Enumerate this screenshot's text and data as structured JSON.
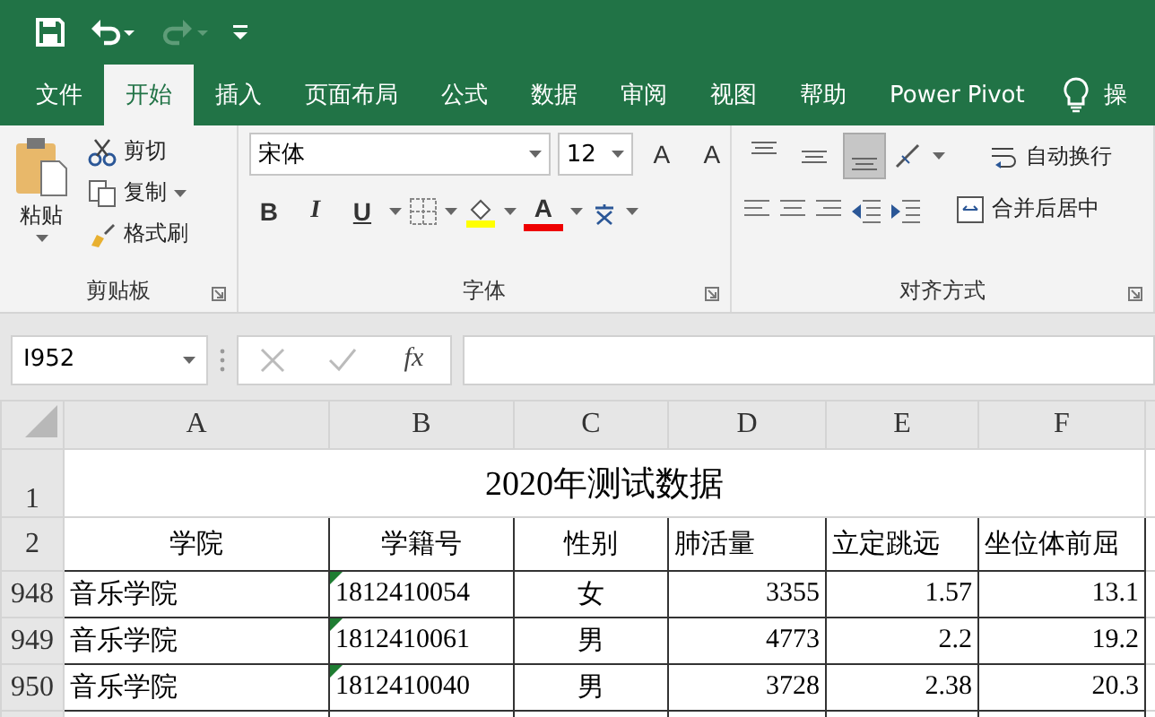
{
  "quick_access": [
    {
      "kind": "save",
      "disabled": false
    },
    {
      "kind": "undo",
      "disabled": false
    },
    {
      "kind": "redo",
      "disabled": true
    },
    {
      "kind": "customize",
      "disabled": false
    }
  ],
  "tabs": [
    {
      "label": "文件",
      "selected": false
    },
    {
      "label": "开始",
      "selected": true
    },
    {
      "label": "插入",
      "selected": false
    },
    {
      "label": "页面布局",
      "selected": false
    },
    {
      "label": "公式",
      "selected": false
    },
    {
      "label": "数据",
      "selected": false
    },
    {
      "label": "审阅",
      "selected": false
    },
    {
      "label": "视图",
      "selected": false
    },
    {
      "label": "帮助",
      "selected": false
    },
    {
      "label": "Power Pivot",
      "selected": false
    }
  ],
  "tell_me": {
    "label": "操"
  },
  "ribbon": {
    "clipboard": {
      "label": "剪贴板",
      "paste": "粘贴",
      "cut": "剪切",
      "copy": "复制",
      "format_painter": "格式刷"
    },
    "font": {
      "label": "字体",
      "font_name": "宋体",
      "font_size": "12",
      "grow": "A",
      "shrink": "A",
      "bold": "B",
      "italic": "I",
      "underline": "U",
      "font_color": "A"
    },
    "alignment": {
      "label": "对齐方式",
      "vertical": [
        {
          "kind": "top",
          "selected": false
        },
        {
          "kind": "middle",
          "selected": false
        },
        {
          "kind": "bottom",
          "selected": true
        }
      ],
      "wrap_text": "自动换行",
      "merge_center": "合并后居中"
    }
  },
  "formula_bar": {
    "name_box": "I952",
    "function_label": "fx"
  },
  "sheet": {
    "columns": [
      {
        "letter": "A"
      },
      {
        "letter": "B"
      },
      {
        "letter": "C"
      },
      {
        "letter": "D"
      },
      {
        "letter": "E"
      },
      {
        "letter": "F"
      }
    ],
    "title_row": {
      "number": "1",
      "title": "2020年测试数据"
    },
    "header_row": {
      "number": "2",
      "cells": [
        "学院",
        "学籍号",
        "性别",
        "肺活量",
        "立定跳远",
        "坐位体前屈"
      ]
    },
    "rows": [
      {
        "number": "948",
        "warning": true,
        "cells": [
          "音乐学院",
          "1812410054",
          "女",
          "3355",
          "1.57",
          "13.1"
        ]
      },
      {
        "number": "949",
        "warning": true,
        "cells": [
          "音乐学院",
          "1812410061",
          "男",
          "4773",
          "2.2",
          "19.2"
        ]
      },
      {
        "number": "950",
        "warning": true,
        "cells": [
          "音乐学院",
          "1812410040",
          "男",
          "3728",
          "2.38",
          "20.3"
        ]
      }
    ]
  }
}
